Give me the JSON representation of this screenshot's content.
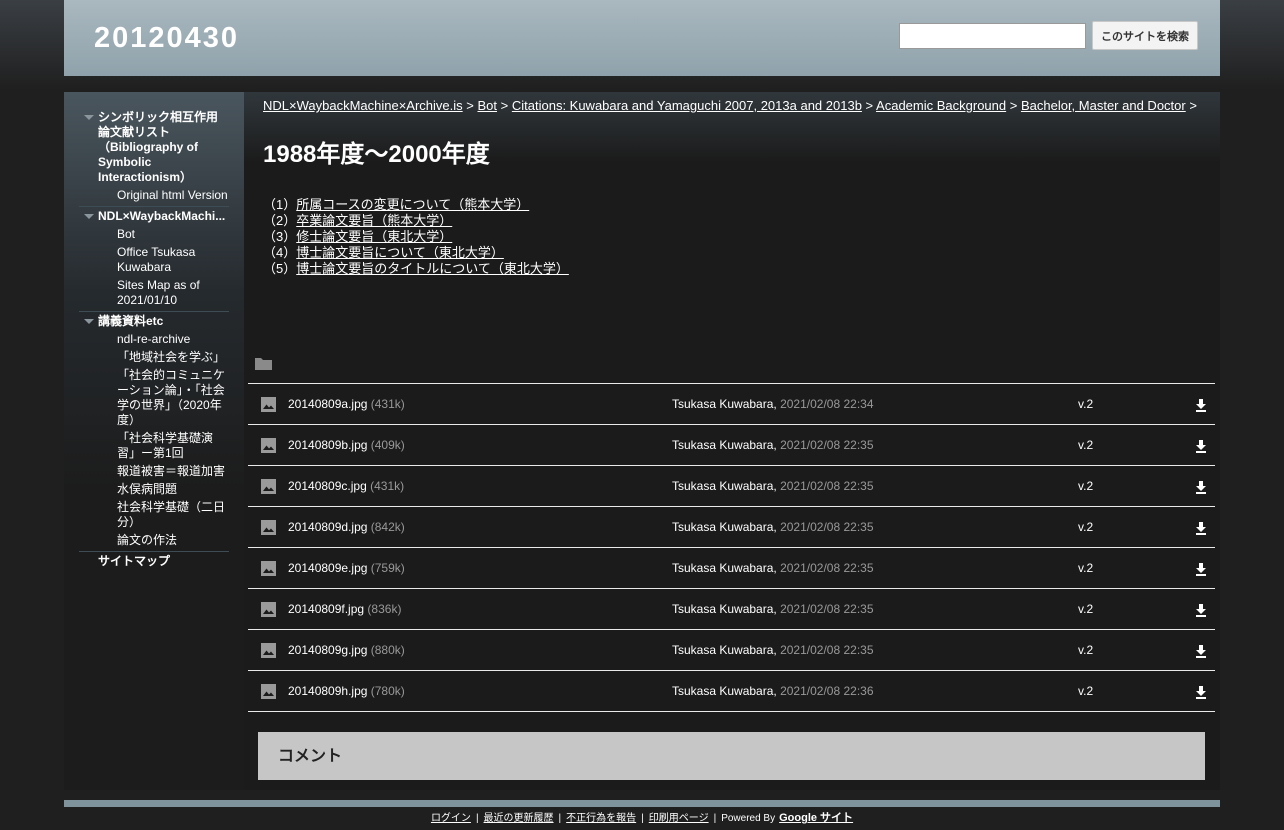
{
  "site": {
    "title": "20120430"
  },
  "search": {
    "placeholder": "",
    "value": "",
    "button_label": "このサイトを検索"
  },
  "sidebar": {
    "groups": [
      {
        "label": "シンボリック相互作用論文献リスト（Bibliography of Symbolic Interactionism）",
        "items": [
          "Original html Version"
        ]
      },
      {
        "label": "NDL×WaybackMachi...",
        "items": [
          "Bot",
          "Office Tsukasa Kuwabara",
          "Sites Map as of 2021/01/10"
        ]
      },
      {
        "label": "講義資料etc",
        "items": [
          "ndl-re-archive",
          "「地域社会を学ぶ」",
          "「社会的コミュニケーション論」・「社会学の世界」（2020年度）",
          "「社会科学基礎演習」ー第1回",
          "報道被害＝報道加害",
          "水俣病問題",
          "社会科学基礎（二日分）",
          "論文の作法"
        ]
      }
    ],
    "sitemap": "サイトマップ"
  },
  "breadcrumb": {
    "items": [
      "NDL×WaybackMachine×Archive.is",
      "Bot",
      "Citations: Kuwabara and Yamaguchi 2007, 2013a and 2013b",
      "Academic Background",
      "Bachelor, Master and Doctor"
    ],
    "separator": ">"
  },
  "page": {
    "title": "1988年度～2000年度",
    "links": [
      {
        "num": "（1）",
        "text": "所属コースの変更について（熊本大学）"
      },
      {
        "num": "（2）",
        "text": "卒業論文要旨（熊本大学）"
      },
      {
        "num": "（3）",
        "text": "修士論文要旨（東北大学）"
      },
      {
        "num": "（4）",
        "text": "博士論文要旨について（東北大学）"
      },
      {
        "num": "（5）",
        "text": "博士論文要旨のタイトルについて（東北大学）"
      }
    ]
  },
  "attachments": [
    {
      "name": "20140809a.jpg",
      "size": "(431k)",
      "author": "Tsukasa Kuwabara,",
      "date": "2021/02/08 22:34",
      "version": "v.2"
    },
    {
      "name": "20140809b.jpg",
      "size": "(409k)",
      "author": "Tsukasa Kuwabara,",
      "date": "2021/02/08 22:35",
      "version": "v.2"
    },
    {
      "name": "20140809c.jpg",
      "size": "(431k)",
      "author": "Tsukasa Kuwabara,",
      "date": "2021/02/08 22:35",
      "version": "v.2"
    },
    {
      "name": "20140809d.jpg",
      "size": "(842k)",
      "author": "Tsukasa Kuwabara,",
      "date": "2021/02/08 22:35",
      "version": "v.2"
    },
    {
      "name": "20140809e.jpg",
      "size": "(759k)",
      "author": "Tsukasa Kuwabara,",
      "date": "2021/02/08 22:35",
      "version": "v.2"
    },
    {
      "name": "20140809f.jpg",
      "size": "(836k)",
      "author": "Tsukasa Kuwabara,",
      "date": "2021/02/08 22:35",
      "version": "v.2"
    },
    {
      "name": "20140809g.jpg",
      "size": "(880k)",
      "author": "Tsukasa Kuwabara,",
      "date": "2021/02/08 22:35",
      "version": "v.2"
    },
    {
      "name": "20140809h.jpg",
      "size": "(780k)",
      "author": "Tsukasa Kuwabara,",
      "date": "2021/02/08 22:36",
      "version": "v.2"
    }
  ],
  "comments": {
    "label": "コメント"
  },
  "footer": {
    "links": [
      "ログイン",
      "最近の更新履歴",
      "不正行為を報告",
      "印刷用ページ"
    ],
    "powered_by": "Powered By",
    "google_sites": "Google サイト"
  },
  "icons": {
    "folder": "folder-icon",
    "image": "image-file-icon",
    "download": "download-arrow-icon",
    "expand": "triangle-down-icon"
  },
  "colors": {
    "header_bg": "#9fb1b9",
    "page_bg": "#1f1f1f",
    "comment_bg": "#c6c6c6",
    "footer_bar": "#7f939d"
  }
}
